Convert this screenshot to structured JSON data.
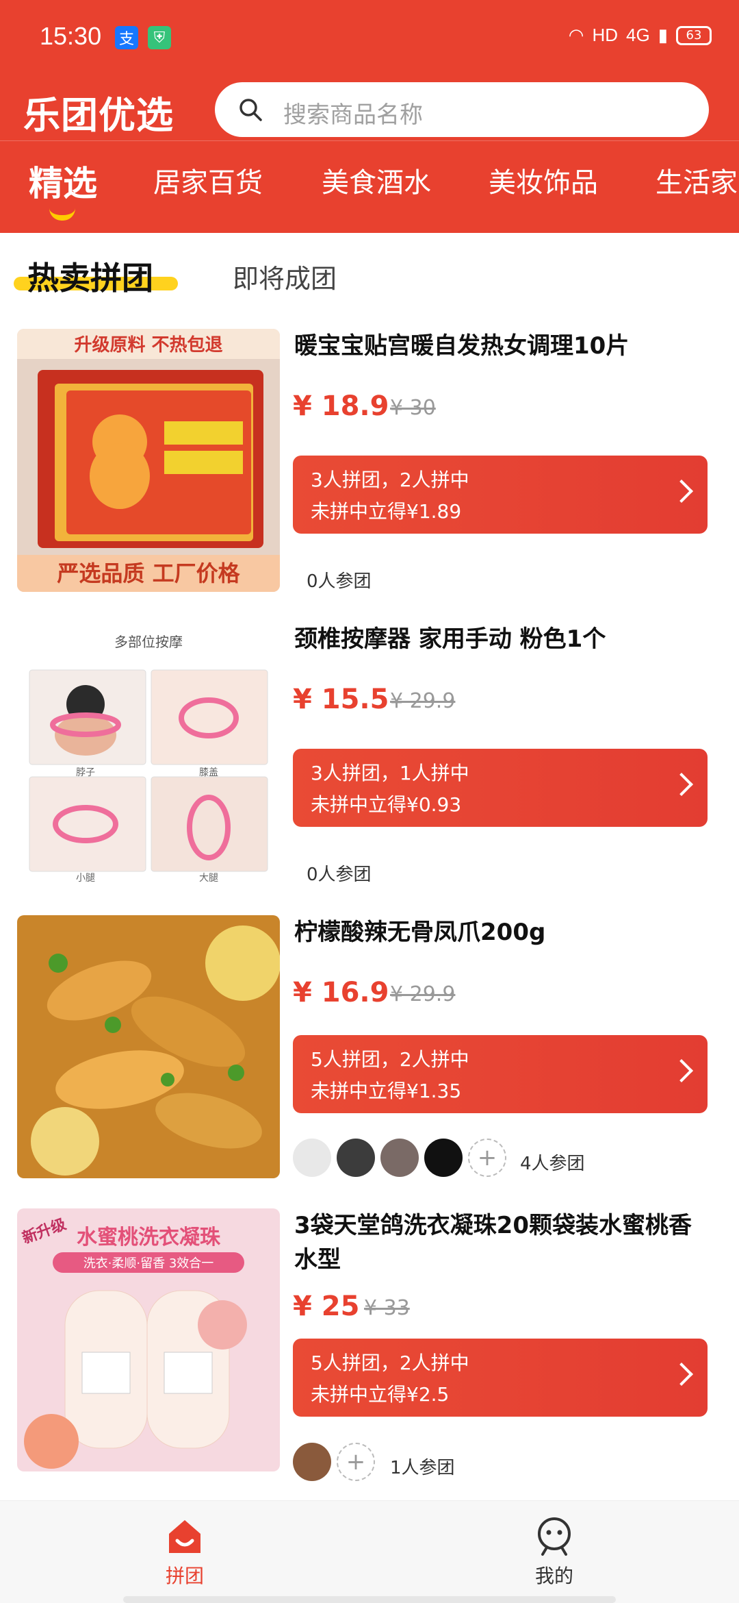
{
  "status_bar": {
    "time": "15:30",
    "network": "HD",
    "signal": "4G",
    "battery": "63"
  },
  "header": {
    "logo": "乐团优选",
    "search_placeholder": "搜索商品名称"
  },
  "categories": [
    {
      "label": "精选",
      "active": true
    },
    {
      "label": "居家百货"
    },
    {
      "label": "美食酒水"
    },
    {
      "label": "美妆饰品"
    },
    {
      "label": "生活家"
    }
  ],
  "sub_tabs": {
    "active": "热卖拼团",
    "other": "即将成团"
  },
  "products": [
    {
      "title": "暖宝宝贴宫暖自发热女调理10片",
      "price": "¥ 18.9",
      "orig": "¥ 30",
      "group_line1": "3人拼团，2人拼中",
      "group_line2": "未拼中立得¥1.89",
      "joined": "0人参团",
      "image_caption_top": "升级原料 不热包退",
      "image_caption_bottom": "严选品质 工厂价格"
    },
    {
      "title": "颈椎按摩器 家用手动 粉色1个",
      "price": "¥ 15.5",
      "orig": "¥ 29.9",
      "group_line1": "3人拼团，1人拼中",
      "group_line2": "未拼中立得¥0.93",
      "joined": "0人参团",
      "image_caption_top": "多部位按摩",
      "image_labels": [
        "脖子",
        "膝盖",
        "小腿",
        "大腿"
      ]
    },
    {
      "title": "柠檬酸辣无骨凤爪200g",
      "price": "¥ 16.9",
      "orig": "¥ 29.9",
      "group_line1": "5人拼团，2人拼中",
      "group_line2": "未拼中立得¥1.35",
      "joined": "4人参团"
    },
    {
      "title": "3袋天堂鸽洗衣凝珠20颗袋装水蜜桃香水型",
      "price": "¥ 25",
      "orig": "¥ 33",
      "group_line1": "5人拼团，2人拼中",
      "group_line2": "未拼中立得¥2.5",
      "joined": "1人参团",
      "image_caption_top": "水蜜桃洗衣凝珠",
      "image_caption_sub": "洗衣·柔顺·留香 3效合一",
      "image_badge": "新升级"
    }
  ],
  "bottom_nav": [
    {
      "label": "拼团",
      "active": true,
      "icon": "home-icon"
    },
    {
      "label": "我的",
      "active": false,
      "icon": "user-icon"
    }
  ],
  "colors": {
    "brand": "#e8412f",
    "tab_underline": "#ffcc00",
    "sub_highlight": "#ffd21e"
  }
}
